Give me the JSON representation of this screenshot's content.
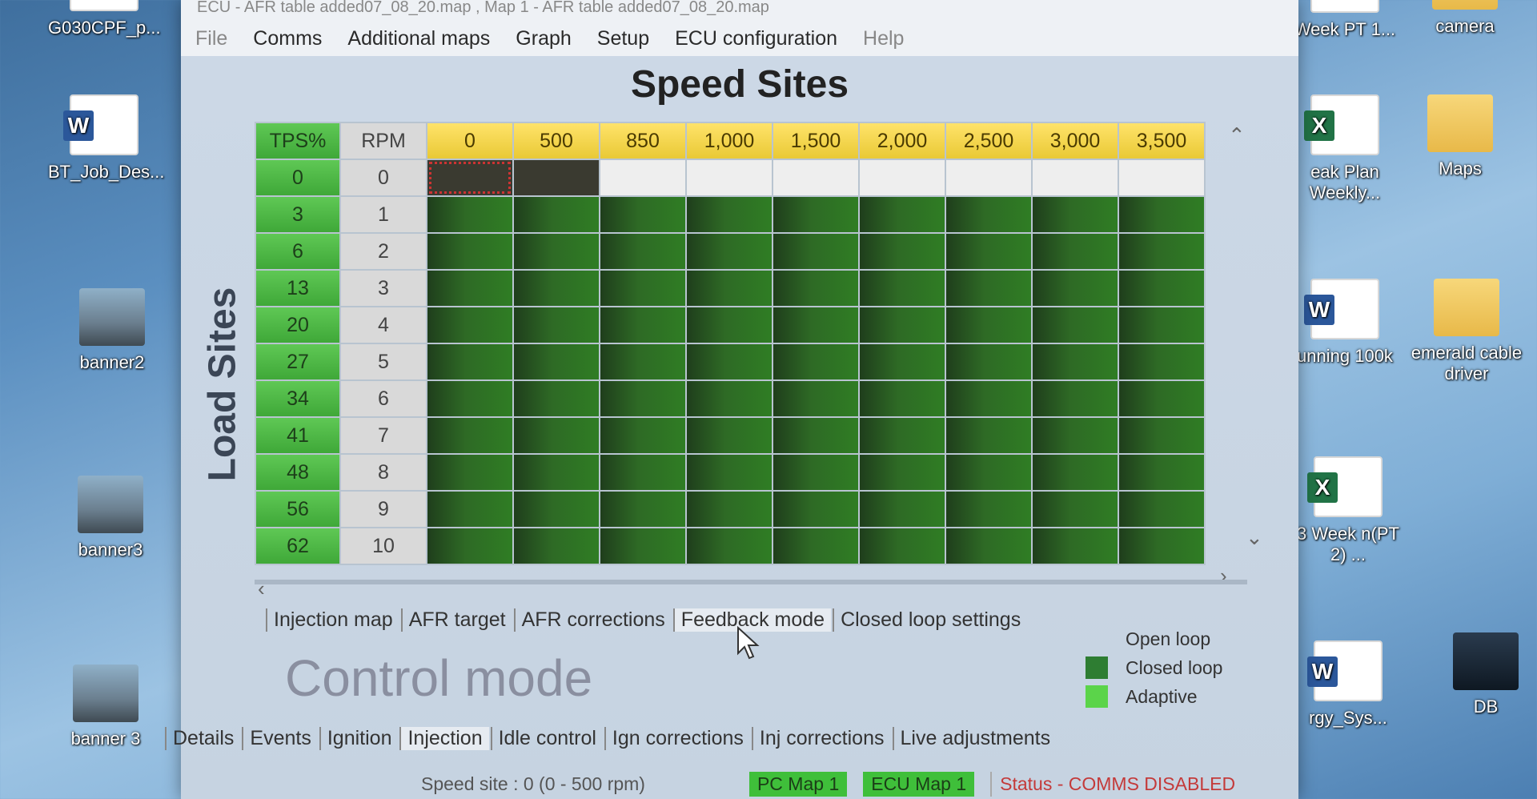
{
  "desktop": {
    "left_icons": [
      {
        "label": "G030CPF_p...",
        "kind": "word"
      },
      {
        "label": "BT_Job_Des...",
        "kind": "word"
      },
      {
        "label": "banner2",
        "kind": "photo"
      },
      {
        "label": "banner3",
        "kind": "photo"
      },
      {
        "label": "banner 3",
        "kind": "photo"
      }
    ],
    "right_icons": [
      {
        "label": "Week PT 1...",
        "kind": "excel"
      },
      {
        "label": "camera",
        "kind": "folder"
      },
      {
        "label": "eak Plan Weekly...",
        "kind": "excel"
      },
      {
        "label": "Maps",
        "kind": "folder"
      },
      {
        "label": "unning 100k",
        "kind": "word"
      },
      {
        "label": "emerald cable driver",
        "kind": "folder"
      },
      {
        "label": "3 Week n(PT 2) ...",
        "kind": "excel"
      },
      {
        "label": "rgy_Sys...",
        "kind": "word"
      },
      {
        "label": "DB",
        "kind": "dark"
      }
    ]
  },
  "window": {
    "title": "ECU - AFR table added07_08_20.map   ,  Map 1 - AFR table added07_08_20.map"
  },
  "menu": [
    "File",
    "Comms",
    "Additional maps",
    "Graph",
    "Setup",
    "ECU configuration",
    "Help"
  ],
  "page": {
    "title": "Speed Sites",
    "vertical_label": "Load Sites",
    "control_mode_label": "Control mode"
  },
  "table": {
    "tps_header": "TPS%",
    "rpm_header": "RPM",
    "speed_sites": [
      "0",
      "500",
      "850",
      "1,000",
      "1,500",
      "2,000",
      "2,500",
      "3,000",
      "3,500"
    ],
    "rows": [
      {
        "tps": "0",
        "rpm": "0"
      },
      {
        "tps": "3",
        "rpm": "1"
      },
      {
        "tps": "6",
        "rpm": "2"
      },
      {
        "tps": "13",
        "rpm": "3"
      },
      {
        "tps": "20",
        "rpm": "4"
      },
      {
        "tps": "27",
        "rpm": "5"
      },
      {
        "tps": "34",
        "rpm": "6"
      },
      {
        "tps": "41",
        "rpm": "7"
      },
      {
        "tps": "48",
        "rpm": "8"
      },
      {
        "tps": "56",
        "rpm": "9"
      },
      {
        "tps": "62",
        "rpm": "10"
      }
    ]
  },
  "tabs_top": [
    "Injection map",
    "AFR target",
    "AFR corrections",
    "Feedback mode",
    "Closed loop settings"
  ],
  "tabs_top_active": "Feedback mode",
  "legend": [
    {
      "label": "Open loop",
      "color": "transparent"
    },
    {
      "label": "Closed loop",
      "color": "#2e7d32"
    },
    {
      "label": "Adaptive",
      "color": "#5bd44a"
    }
  ],
  "tabs_bottom": [
    "Details",
    "Events",
    "Ignition",
    "Injection",
    "Idle control",
    "Ign corrections",
    "Inj corrections",
    "Live adjustments"
  ],
  "tabs_bottom_active": "Injection",
  "status": {
    "speed_site": "Speed site : 0 (0 - 500 rpm)",
    "pc_map": "PC Map 1",
    "ecu_map": "ECU Map 1",
    "comms": "Status - COMMS DISABLED"
  }
}
